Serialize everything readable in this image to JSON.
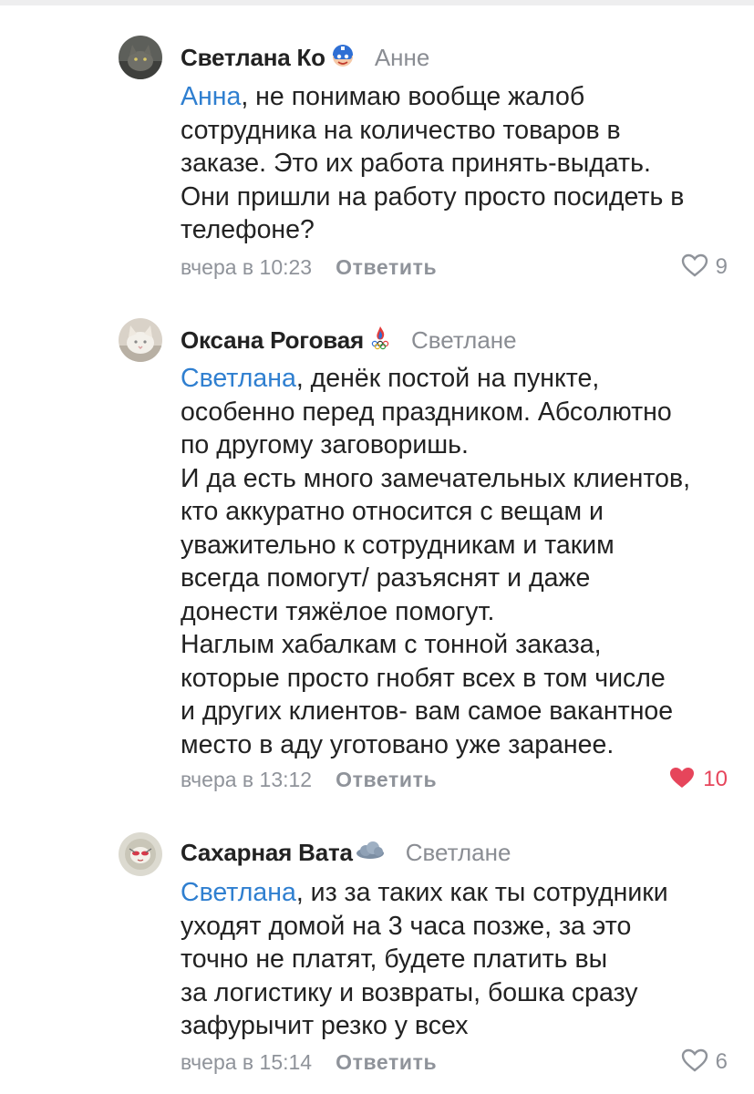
{
  "comments": [
    {
      "author": "Светлана Ко",
      "reply_to": "Анне",
      "mention": "Анна",
      "text_lines": [
        ", не понимаю вообще жалоб",
        "сотрудника на количество товаров в",
        "заказе. Это их работа принять-выдать.",
        "Они пришли на работу просто посидеть в",
        "телефоне?"
      ],
      "time": "вчера в 10:23",
      "reply_label": "Ответить",
      "likes": "9",
      "liked": false,
      "badge_icon": "superhero-emoji-icon"
    },
    {
      "author": "Оксана Роговая",
      "reply_to": "Светлане",
      "mention": "Светлана",
      "text_lines": [
        ", денёк постой на пункте,",
        "особенно перед праздником. Абсолютно",
        "по другому заговоришь.",
        "И да есть много замечательных клиентов,",
        "кто аккуратно относится с вещам и",
        "уважительно к сотрудникам и таким",
        "всегда помогут/ разъяснят и даже",
        "донести тяжёлое помогут.",
        "Наглым хабалкам с тонной заказа,",
        "которые просто гнобят всех в том числе",
        "и других клиентов- вам самое вакантное",
        "место в аду уготовано уже заранее."
      ],
      "time": "вчера в 13:12",
      "reply_label": "Ответить",
      "likes": "10",
      "liked": true,
      "badge_icon": "olympic-flame-icon"
    },
    {
      "author": "Сахарная Вата",
      "reply_to": "Светлане",
      "mention": "Светлана",
      "text_lines": [
        ", из за таких как ты сотрудники",
        "уходят домой на 3 часа позже, за это",
        "точно не платят, будете платить вы",
        "за логистику и возвраты, бошка сразу",
        "зафурычит резко у всех"
      ],
      "time": "вчера в 15:14",
      "reply_label": "Ответить",
      "likes": "6",
      "liked": false,
      "badge_icon": "cloud-icon"
    }
  ],
  "colors": {
    "mention": "#2f7fd0",
    "muted": "#8f939a",
    "like_active": "#e6455b",
    "text": "#222222"
  }
}
